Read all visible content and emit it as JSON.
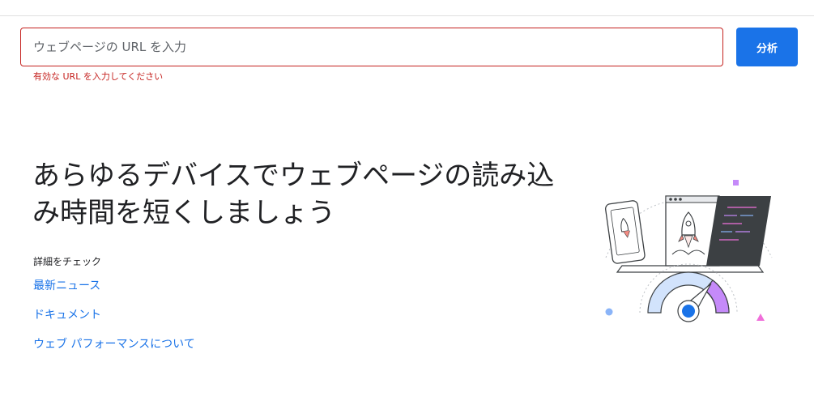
{
  "search": {
    "placeholder": "ウェブページの URL を入力",
    "value": "",
    "error": "有効な URL を入力してください"
  },
  "analyze_button": {
    "label": "分析"
  },
  "hero": {
    "title": "あらゆるデバイスでウェブページの読み込み時間を短くしましょう"
  },
  "links": {
    "heading": "詳細をチェック",
    "items": [
      {
        "label": "最新ニュース"
      },
      {
        "label": "ドキュメント"
      },
      {
        "label": "ウェブ パフォーマンスについて"
      }
    ]
  },
  "colors": {
    "accent": "#1a73e8",
    "error": "#c5221f",
    "illustration_purple": "#c58af9",
    "illustration_pink": "#f06fda",
    "illustration_blue": "#8ab4f8"
  },
  "illustration": {
    "icon": "rocket-speed-gauge-illustration"
  }
}
